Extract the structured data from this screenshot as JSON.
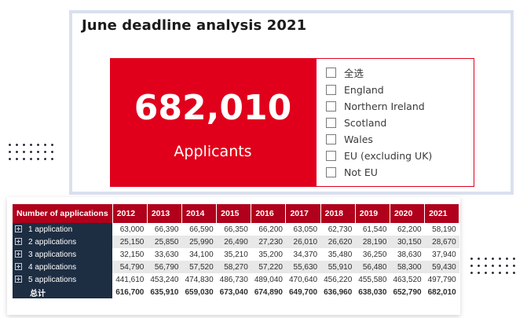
{
  "dashboard": {
    "title": "June deadline analysis 2021",
    "kpi": {
      "value": "682,010",
      "label": "Applicants",
      "color": "#e0001b"
    },
    "slicer": {
      "items": [
        "全选",
        "England",
        "Northern Ireland",
        "Scotland",
        "Wales",
        "EU (excluding UK)",
        "Not EU"
      ]
    }
  },
  "table": {
    "corner_header": "Number of applications",
    "years": [
      "2012",
      "2013",
      "2014",
      "2015",
      "2016",
      "2017",
      "2018",
      "2019",
      "2020",
      "2021"
    ],
    "rows": [
      {
        "label": "1 application",
        "values": [
          "63,000",
          "66,390",
          "66,590",
          "66,350",
          "66,200",
          "63,050",
          "62,730",
          "61,540",
          "62,200",
          "58,190"
        ]
      },
      {
        "label": "2 applications",
        "values": [
          "25,150",
          "25,850",
          "25,990",
          "26,490",
          "27,230",
          "26,010",
          "26,620",
          "28,190",
          "30,150",
          "28,670"
        ]
      },
      {
        "label": "3 applications",
        "values": [
          "32,150",
          "33,630",
          "34,100",
          "35,210",
          "35,200",
          "34,370",
          "35,480",
          "36,250",
          "38,630",
          "37,940"
        ]
      },
      {
        "label": "4 applications",
        "values": [
          "54,790",
          "56,790",
          "57,520",
          "58,270",
          "57,220",
          "55,630",
          "55,910",
          "56,480",
          "58,300",
          "59,430"
        ]
      },
      {
        "label": "5 applications",
        "values": [
          "441,610",
          "453,240",
          "474,830",
          "486,730",
          "489,040",
          "470,640",
          "456,220",
          "455,580",
          "463,520",
          "497,790"
        ]
      }
    ],
    "total": {
      "label": "总计",
      "values": [
        "616,700",
        "635,910",
        "659,030",
        "673,040",
        "674,890",
        "649,700",
        "636,960",
        "638,030",
        "652,790",
        "682,010"
      ]
    },
    "colors": {
      "header": "#b0001b",
      "row_header": "#1d2d42",
      "alt_row": "#e8e8e8"
    }
  }
}
